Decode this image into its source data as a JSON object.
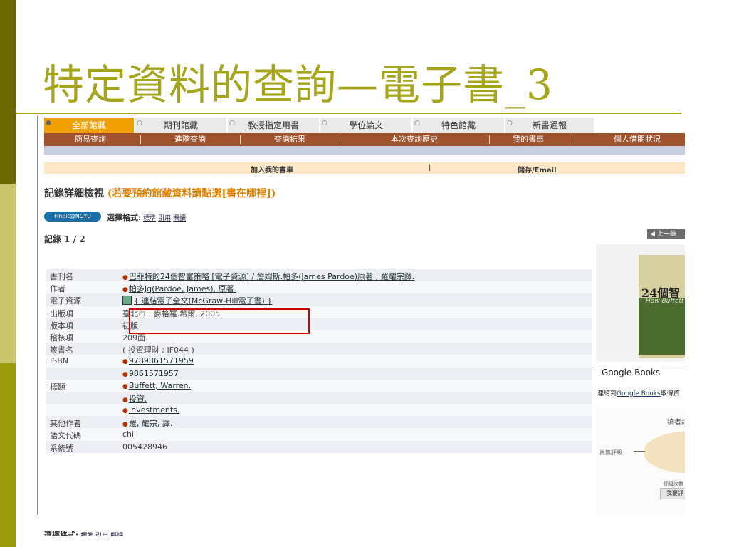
{
  "slide": {
    "title": "特定資料的查詢—電子書_3"
  },
  "tabs": [
    "全部館藏",
    "期刊館藏",
    "教授指定用書",
    "學位論文",
    "特色館藏",
    "新書通報"
  ],
  "nav": [
    "簡易查詢",
    "進階查詢",
    "查詢結果",
    "本次查詢歷史",
    "我的書車",
    "個人借閱狀況"
  ],
  "actions": {
    "add_cart": "加入我的書車",
    "save_email": "儲存/Email"
  },
  "record": {
    "heading": "記錄詳細檢視",
    "hint": "(若要預約館藏資料請點選[書在哪裡])",
    "findit": "Findit@NCYU",
    "format_label": "選擇格式:",
    "formats": [
      "標準",
      "引用",
      "概讀"
    ],
    "counter": "記錄 1 / 2"
  },
  "fields": [
    {
      "label": "書刊名",
      "value": "巴菲特的24個智富策略 [電子資源] / 詹姆斯.帕多(James Pardoe)原著 ; 羅耀宗譯.",
      "link": true
    },
    {
      "label": "作者",
      "value": "帕多Jq(Pardoe, James), 原著.",
      "link": true
    },
    {
      "label": "電子資源",
      "value": "{ 連結電子全文(McGraw-Hill電子書) }",
      "link": true,
      "ebook": true
    },
    {
      "label": "出版項",
      "value": "臺北市 : 麥格羅.希爾, 2005.",
      "link": false
    },
    {
      "label": "版本項",
      "value": "初版",
      "link": false
    },
    {
      "label": "稽核項",
      "value": "209面.",
      "link": false
    },
    {
      "label": "叢書名",
      "value": "( 投資理財 ; IF044 )",
      "link": false
    },
    {
      "label": "ISBN",
      "value": "9789861571959",
      "link": true
    },
    {
      "label": "",
      "value": "9861571957",
      "link": true
    },
    {
      "label": "標題",
      "value": "Buffett, Warren.",
      "link": true
    },
    {
      "label": "",
      "value": "投資.",
      "link": true
    },
    {
      "label": "",
      "value": "Investments.",
      "link": true
    },
    {
      "label": "其他作者",
      "value": "羅, 耀宗, 譯.",
      "link": true
    },
    {
      "label": "語文代碼",
      "value": "chi",
      "link": false
    },
    {
      "label": "系統號",
      "value": "005428946",
      "link": false
    }
  ],
  "side": {
    "prev": "上一筆",
    "cover_title": "24個智",
    "cover_english": "How Buffett",
    "google_books": "Google Books",
    "gb_prefix": "連結到",
    "gb_link": "Google Books",
    "gb_suffix": "取得資",
    "ratings_title": "讀者評",
    "no_rating": "尚無評級",
    "rating_stats": "評級次數",
    "rate_button": "我要評"
  },
  "colors": {
    "accent": "#a5a51a",
    "tab_active": "#f0a000",
    "navbar": "#a0522d",
    "highlight": "#d00000"
  }
}
